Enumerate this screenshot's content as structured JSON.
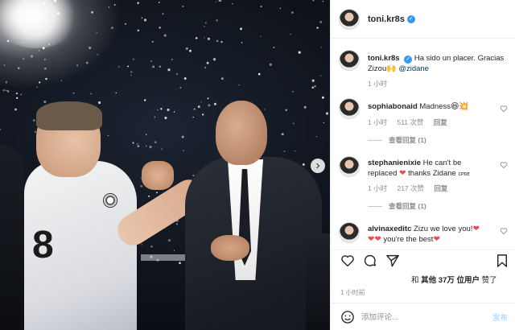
{
  "post": {
    "author": "toni.kr8s",
    "verified": true,
    "photo_alt": "Toni Kroos and Zidane embracing at night in a stadium"
  },
  "caption": {
    "username": "toni.kr8s",
    "text": "Ha sido un placer. Gracias Zizou",
    "emoji": "🙌",
    "mention": "@zidane",
    "time": "1 小时"
  },
  "comments": [
    {
      "username": "sophiabonaid",
      "text": "Madness",
      "emoji": "😆💥",
      "time": "1 小时",
      "likes": "511 次赞",
      "reply_label": "回复",
      "view_replies": "查看回复 (1)"
    },
    {
      "username": "stephanienixie",
      "text_line1": "He can't be",
      "text_line2a": "replaced",
      "text_line2b": "thanks Zidane",
      "text_line2c": "ᴄᴘᴅᴇ",
      "time": "1 小时",
      "likes": "217 次赞",
      "reply_label": "回复",
      "view_replies": "查看回复 (1)"
    },
    {
      "username": "alvinaxeditc",
      "text_line1": "Zizu we love you!",
      "text_line2": "you're the best"
    }
  ],
  "likes_summary": {
    "prefix": "和",
    "others": "其他 37万 位用户",
    "suffix": "赞了"
  },
  "timestamp": "1 小时前",
  "composer": {
    "placeholder": "添加评论...",
    "post_label": "发布"
  },
  "colors": {
    "verified": "#3897f0",
    "link": "#00376b",
    "heart": "#ed4956",
    "post_disabled": "#b2dffc"
  }
}
